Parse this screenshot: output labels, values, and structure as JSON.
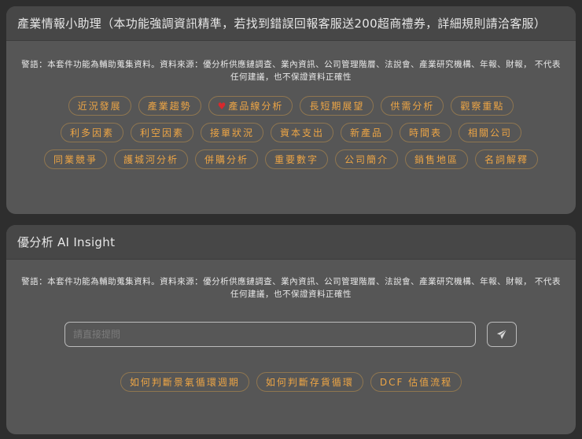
{
  "panel1": {
    "title": "產業情報小助理（本功能強調資訊精準，若找到錯誤回報客服送200超商禮券，詳細規則請洽客服）",
    "warning": "警語：本套件功能為輔助蒐集資料。資料來源：優分析供應鏈調查、業內資訊、公司管理階層、法說會、產業研究機構、年報、財報， 不代表任何建議，也不保證資料正確性",
    "chips": [
      {
        "label": "近況發展"
      },
      {
        "label": "產業趨勢"
      },
      {
        "label": "產品線分析",
        "icon": "heart-icon"
      },
      {
        "label": "長短期展望"
      },
      {
        "label": "供需分析"
      },
      {
        "label": "觀察重點"
      },
      {
        "label": "利多因素"
      },
      {
        "label": "利空因素"
      },
      {
        "label": "接單狀況"
      },
      {
        "label": "資本支出"
      },
      {
        "label": "新產品"
      },
      {
        "label": "時間表"
      },
      {
        "label": "相關公司"
      },
      {
        "label": "同業競爭"
      },
      {
        "label": "護城河分析"
      },
      {
        "label": "併購分析"
      },
      {
        "label": "重要數字"
      },
      {
        "label": "公司簡介"
      },
      {
        "label": "銷售地區"
      },
      {
        "label": "名詞解釋"
      }
    ]
  },
  "panel2": {
    "title": "優分析 AI Insight",
    "warning": "警語：本套件功能為輔助蒐集資料。資料來源：優分析供應鏈調查、業內資訊、公司管理階層、法說會、產業研究機構、年報、財報， 不代表任何建議，也不保證資料正確性",
    "input_placeholder": "請直接提問",
    "chips": [
      {
        "label": "如何判斷景氣循環週期"
      },
      {
        "label": "如何判斷存貨循環"
      },
      {
        "label": "DCF 估值流程"
      }
    ]
  },
  "colors": {
    "accent": "#eda545",
    "heart": "#d8282c"
  }
}
